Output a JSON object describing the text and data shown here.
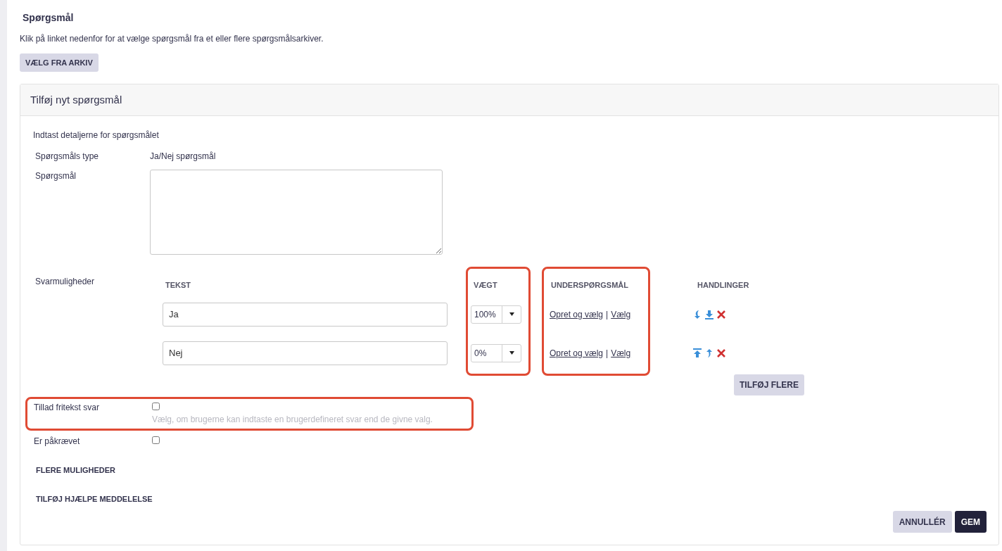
{
  "page": {
    "title": "Spørgsmål",
    "intro": "Klik på linket nedenfor for at vælge spørgsmål fra et eller flere spørgsmålsarkiver.",
    "archive_button": "VÆLG FRA ARKIV"
  },
  "card": {
    "title": "Tilføj nyt spørgsmål",
    "instruction": "Indtast detaljerne for spørgsmålet",
    "fields": [
      {
        "kind": "text",
        "label": "Spørgsmåls type",
        "value": "Ja/Nej spørgsmål"
      },
      {
        "kind": "textarea",
        "label": "Spørgsmål"
      }
    ],
    "answers": {
      "label": "Svarmuligheder",
      "columns": [
        {
          "label": "TEKST",
          "highlighted": false
        },
        {
          "label": "VÆGT",
          "highlighted": true
        },
        {
          "label": "UNDERSPØRGSMÅL",
          "highlighted": true
        },
        {
          "label": "HANDLINGER",
          "highlighted": false
        }
      ],
      "rows": [
        {
          "text": "Ja",
          "weight": "100%",
          "create_link": "Opret og vælg",
          "separator": "|",
          "choose_link": "Vælg",
          "actions": [
            {
              "kind": "move-down"
            },
            {
              "kind": "move-bottom"
            },
            {
              "kind": "delete"
            }
          ]
        },
        {
          "text": "Nej",
          "weight": "0%",
          "create_link": "Opret og vælg",
          "separator": "|",
          "choose_link": "Vælg",
          "actions": [
            {
              "kind": "move-top"
            },
            {
              "kind": "move-up"
            },
            {
              "kind": "delete"
            }
          ]
        }
      ],
      "add_button": "TILFØJ FLERE"
    },
    "options": [
      {
        "label": "Tillad fritekst svar",
        "checked": false,
        "hint": "Vælg, om brugerne kan indtaste en brugerdefineret svar end de givne valg.",
        "highlighted": true
      },
      {
        "label": "Er påkrævet",
        "checked": false,
        "highlighted": false
      }
    ],
    "links": [
      "FLERE MULIGHEDER",
      "TILFØJ HJÆLPE MEDDELELSE"
    ],
    "buttons": [
      {
        "label": "ANNULLÉR",
        "kind": "secondary"
      },
      {
        "label": "GEM",
        "kind": "primary"
      }
    ]
  }
}
